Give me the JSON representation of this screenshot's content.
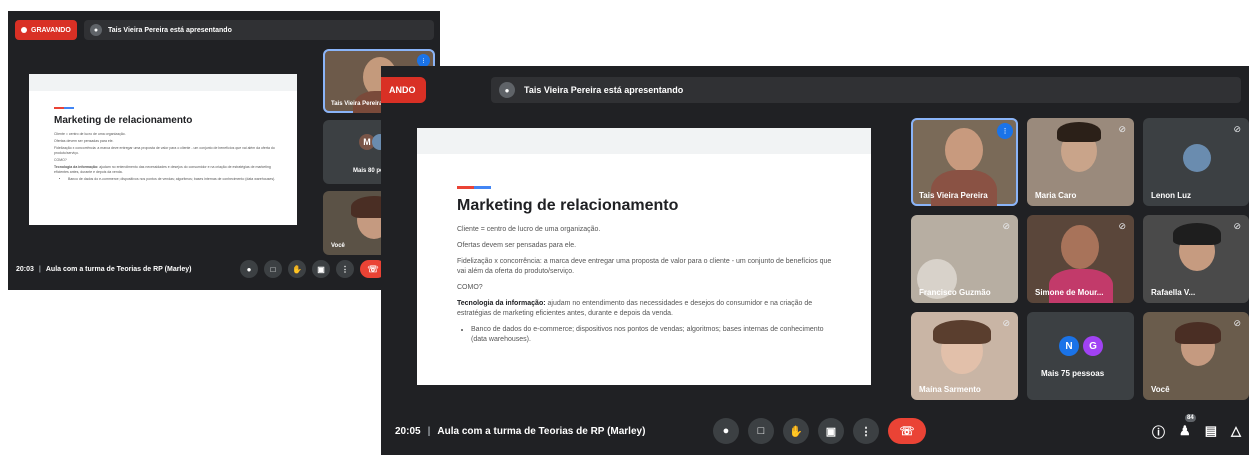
{
  "w1": {
    "recording_label": "GRAVANDO",
    "presenter_text": "Tais Vieira Pereira está apresentando",
    "time": "20:03",
    "meeting_title": "Aula com a turma de Teorias de RP (Marley)",
    "tiles": [
      {
        "name": "Tais Vieira Pereira"
      },
      {
        "name": "Mais 80 pessoas",
        "avatar_letter": "M"
      },
      {
        "name": "Você"
      }
    ]
  },
  "w2": {
    "recording_label": "ANDO",
    "presenter_text": "Tais Vieira Pereira está apresentando",
    "time": "20:05",
    "meeting_title": "Aula com a turma de Teorias de RP (Marley)",
    "participant_count_badge": "84",
    "tiles": [
      {
        "name": "Tais Vieira Pereira"
      },
      {
        "name": "Maria Caro"
      },
      {
        "name": "Lenon Luz"
      },
      {
        "name": "Francisco Guzmão"
      },
      {
        "name": "Simone de Mour..."
      },
      {
        "name": "Rafaella V..."
      },
      {
        "name": "Maína Sarmento"
      },
      {
        "name": "Mais 75 pessoas",
        "avatar_letters": [
          "N",
          "G"
        ]
      },
      {
        "name": "Você"
      }
    ]
  },
  "slide": {
    "title": "Marketing de relacionamento",
    "line1": "Cliente = centro de lucro de uma organização.",
    "line2": "Ofertas devem ser pensadas para ele.",
    "line3": "Fidelização x concorrência: a marca deve entregar uma proposta de valor para o cliente - um conjunto de benefícios que vai além da oferta do produto/serviço.",
    "line4": "COMO?",
    "tech_bold": "Tecnologia da informação:",
    "tech_rest": " ajudam no entendimento das necessidades e desejos do consumidor e na criação de estratégias de marketing eficientes antes, durante e depois da venda.",
    "bullet": "Banco de dados do e-commerce; dispositivos nos pontos de vendas; algoritmos; bases internas de conhecimento (data warehouses)."
  },
  "colors": {
    "background": "#202124",
    "tile": "#3c4043",
    "recording": "#d93025",
    "end_call": "#ea4335",
    "speaking_border": "#8ab4f8",
    "avatar_n": "#1a73e8",
    "avatar_g": "#a142f4",
    "avatar_m": "#795548"
  },
  "icons": [
    "record-dot-icon",
    "presenter-icon",
    "mic-icon",
    "camera-icon",
    "raise-hand-icon",
    "present-icon",
    "more-icon",
    "end-call-icon",
    "info-icon",
    "people-icon",
    "chat-icon",
    "activities-icon",
    "mic-off-icon",
    "speaking-icon"
  ]
}
